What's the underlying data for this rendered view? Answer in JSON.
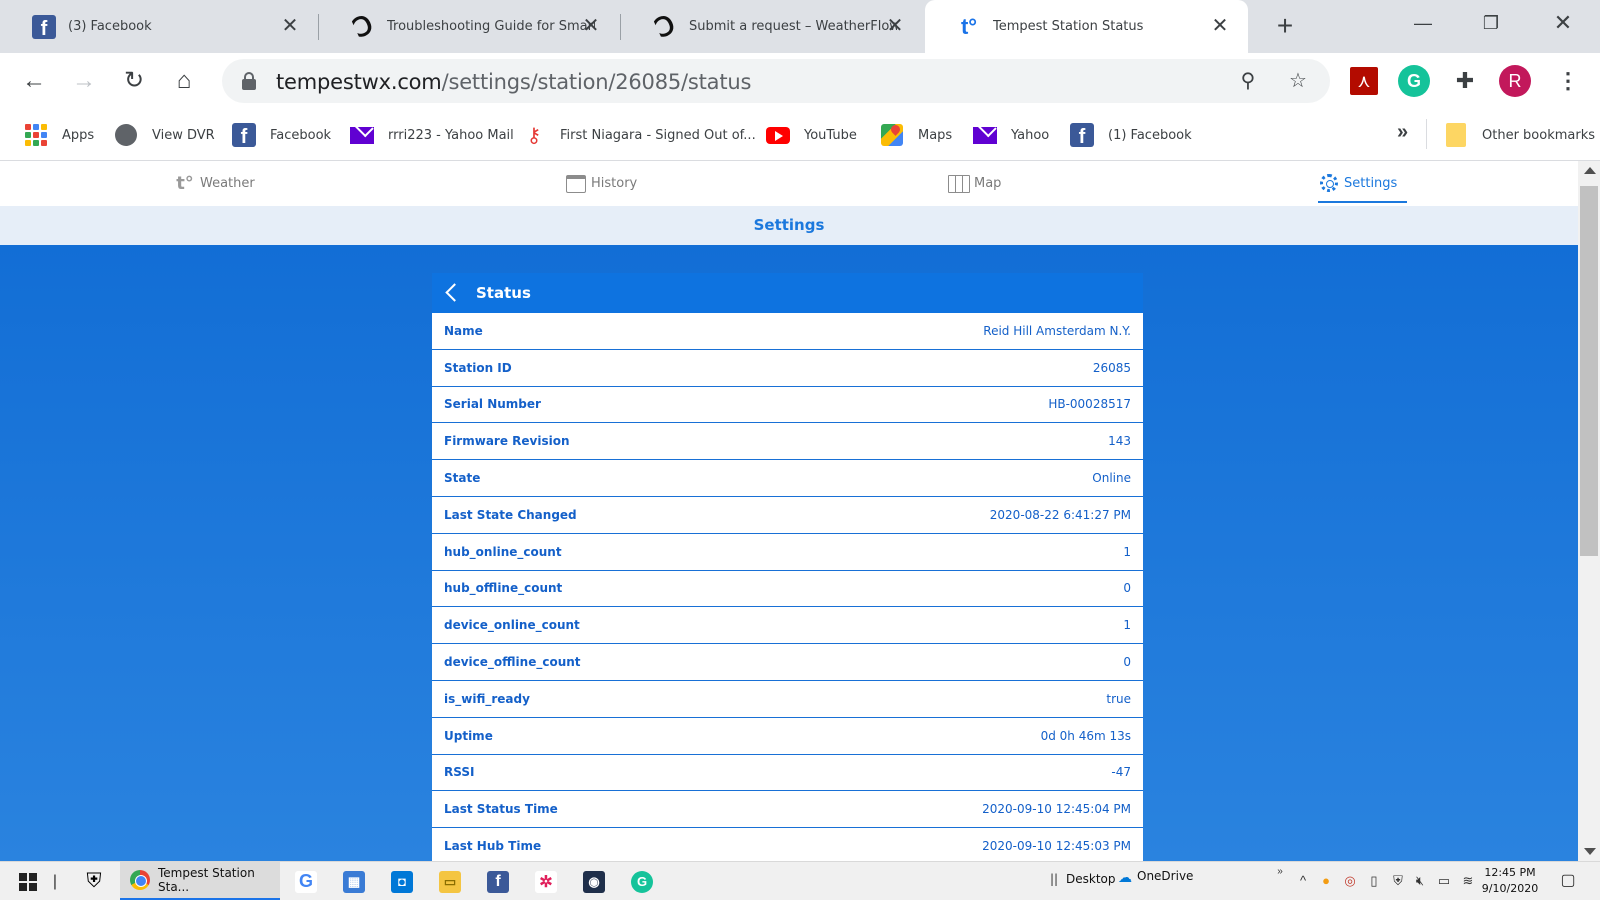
{
  "browser": {
    "tabs": [
      {
        "title": "(3) Facebook",
        "icon": "facebook-icon"
      },
      {
        "title": "Troubleshooting Guide for Smart We",
        "icon": "weatherflow-icon"
      },
      {
        "title": "Submit a request – WeatherFlow Sup",
        "icon": "weatherflow-icon"
      },
      {
        "title": "Tempest Station Status",
        "icon": "tempest-icon"
      }
    ],
    "url_host": "tempestwx.com",
    "url_path": "/settings/station/26085/status",
    "profile_initial": "R",
    "bookmarks": [
      {
        "label": "Apps",
        "icon": "apps-grid-icon"
      },
      {
        "label": "View DVR",
        "icon": "globe-icon"
      },
      {
        "label": "Facebook",
        "icon": "facebook-icon"
      },
      {
        "label": "rrri223 - Yahoo Mail",
        "icon": "yahoo-mail-icon"
      },
      {
        "label": "First Niagara - Signed Out of...",
        "icon": "key-icon"
      },
      {
        "label": "YouTube",
        "icon": "youtube-icon"
      },
      {
        "label": "Maps",
        "icon": "maps-icon"
      },
      {
        "label": "Yahoo",
        "icon": "yahoo-mail-icon"
      },
      {
        "label": "(1) Facebook",
        "icon": "facebook-icon"
      }
    ],
    "other_bookmarks": "Other bookmarks"
  },
  "site": {
    "nav": {
      "weather": "Weather",
      "history": "History",
      "map": "Map",
      "settings": "Settings"
    },
    "section_title": "Settings",
    "panel_title": "Status",
    "rows": [
      {
        "key": "Name",
        "value": "Reid Hill Amsterdam N.Y."
      },
      {
        "key": "Station ID",
        "value": "26085"
      },
      {
        "key": "Serial Number",
        "value": "HB-00028517"
      },
      {
        "key": "Firmware Revision",
        "value": "143"
      },
      {
        "key": "State",
        "value": "Online"
      },
      {
        "key": "Last State Changed",
        "value": "2020-08-22 6:41:27 PM"
      },
      {
        "key": "hub_online_count",
        "value": "1"
      },
      {
        "key": "hub_offline_count",
        "value": "0"
      },
      {
        "key": "device_online_count",
        "value": "1"
      },
      {
        "key": "device_offline_count",
        "value": "0"
      },
      {
        "key": "is_wifi_ready",
        "value": "true"
      },
      {
        "key": "Uptime",
        "value": "0d 0h 46m 13s"
      },
      {
        "key": "RSSI",
        "value": "-47"
      },
      {
        "key": "Last Status Time",
        "value": "2020-09-10 12:45:04 PM"
      },
      {
        "key": "Last Hub Time",
        "value": "2020-09-10 12:45:03 PM"
      }
    ]
  },
  "taskbar": {
    "active_task": "Tempest Station Sta...",
    "desktop_label": "Desktop",
    "onedrive_label": "OneDrive",
    "time": "12:45 PM",
    "date": "9/10/2020"
  },
  "colors": {
    "accent": "#1b78dd",
    "panel_header": "#0e73e0",
    "row_text": "#1460c9",
    "background_top": "#0f6bd4",
    "background_bottom": "#2a83df"
  }
}
